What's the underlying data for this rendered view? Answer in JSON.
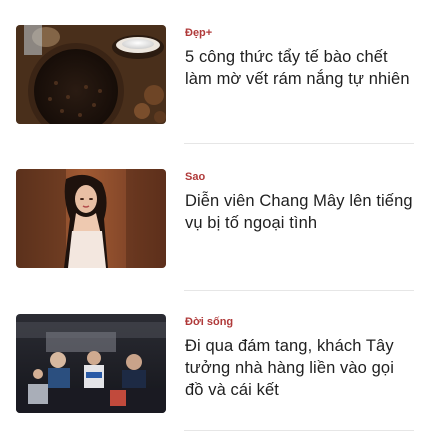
{
  "articles": [
    {
      "category": "Đẹp+",
      "title": "5 công thức tẩy tế bào chết làm mờ vết rám nắng tự nhiên",
      "thumbnail": "coffee-scrub-image"
    },
    {
      "category": "Sao",
      "title": "Diễn viên Chang Mây lên tiếng vụ bị tố ngoại tình",
      "thumbnail": "actress-portrait-image"
    },
    {
      "category": "Đời sống",
      "title": "Đi qua đám tang, khách Tây tưởng nhà hàng liền vào gọi đồ và cái kết",
      "thumbnail": "funeral-crowd-image"
    }
  ],
  "colors": {
    "category": "#b03a3a",
    "headline": "#1f1f1f",
    "divider": "#e6e6e6"
  }
}
